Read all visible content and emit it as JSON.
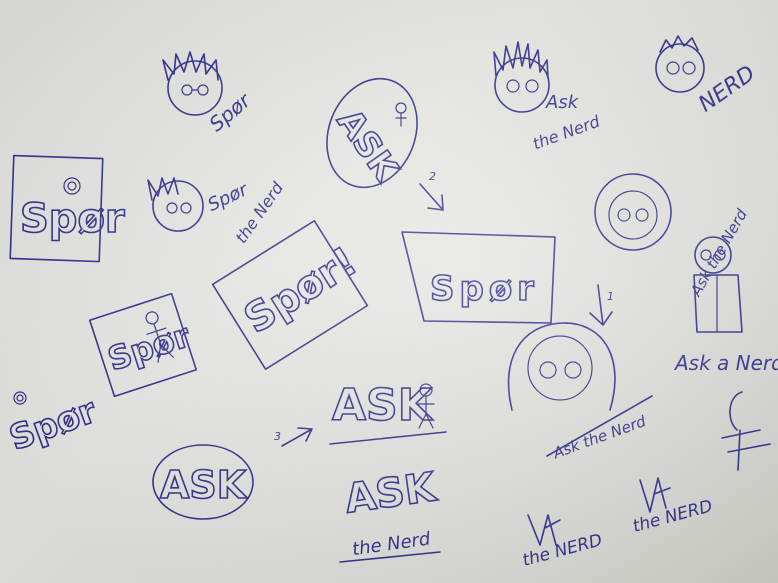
{
  "sketches": {
    "spor_small": "Spør",
    "spor_the_nerd": {
      "line1": "Spør",
      "line2": "the Nerd"
    },
    "spor_box": "Spør",
    "spor_tilted": "Spør!",
    "spor_stick": "Spør",
    "spor_bottom_left": "Spør",
    "spor_top_right_box": "Spør",
    "ask_oval_top": "ASK",
    "ask_the_nerd_top": {
      "line1": "Ask",
      "line2": "the Nerd"
    },
    "nerd_top_right": "NERD",
    "ask_the_nerd_circle": "Ask the Nerd",
    "ask_a_nerd": "Ask a Nerd",
    "ask_the_nerd_portrait": "Ask the Nerd",
    "ask_stick": "ASK",
    "ask_oval_bottom": "ASK",
    "ask_the_nerd_bottom": {
      "line1": "ASK",
      "line2": "the Nerd"
    },
    "the_nerd_scribble_1": "the NERD",
    "the_nerd_scribble_2": "the NERD",
    "number_2": "2",
    "number_3": "3",
    "number_1": "1"
  },
  "colors": {
    "ink": "#2c2a8a",
    "paper": "#e3e3df"
  }
}
